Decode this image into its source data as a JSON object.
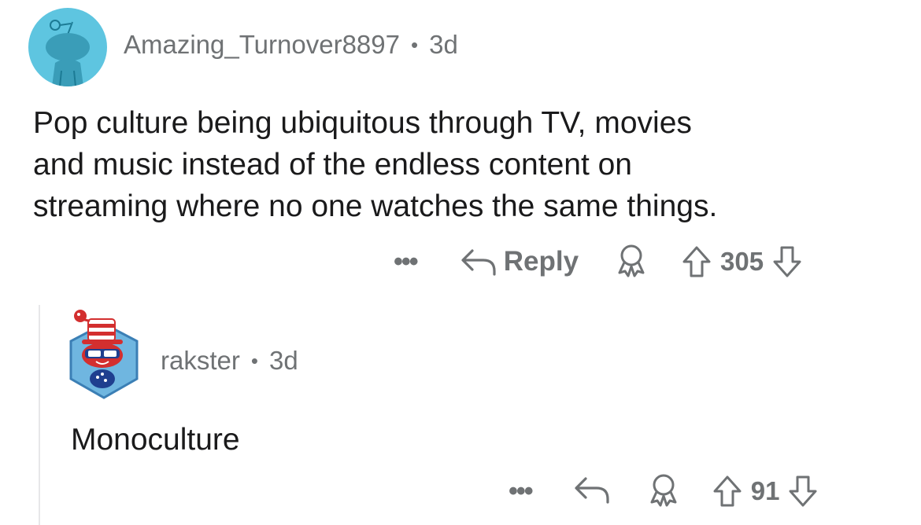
{
  "parent_comment": {
    "username": "Amazing_Turnover8897",
    "separator": "•",
    "age": "3d",
    "body_lines": [
      "Pop culture being ubiquitous through TV, movies",
      "and music instead of the endless content on",
      "streaming where no one watches the same things."
    ],
    "more_label": "•••",
    "reply_label": "Reply",
    "score": "305",
    "avatar_color": "#5ec5e0"
  },
  "reply_comment": {
    "username": "rakster",
    "separator": "•",
    "age": "3d",
    "body": "Monoculture",
    "more_label": "•••",
    "score": "91"
  },
  "icons": {
    "parent_avatar": "snoo-avatar-icon",
    "reply_avatar": "patriotic-snoo-avatar-icon",
    "reply": "reply-arrow-icon",
    "award": "award-icon",
    "upvote": "upvote-arrow-icon",
    "downvote": "downvote-arrow-icon"
  }
}
